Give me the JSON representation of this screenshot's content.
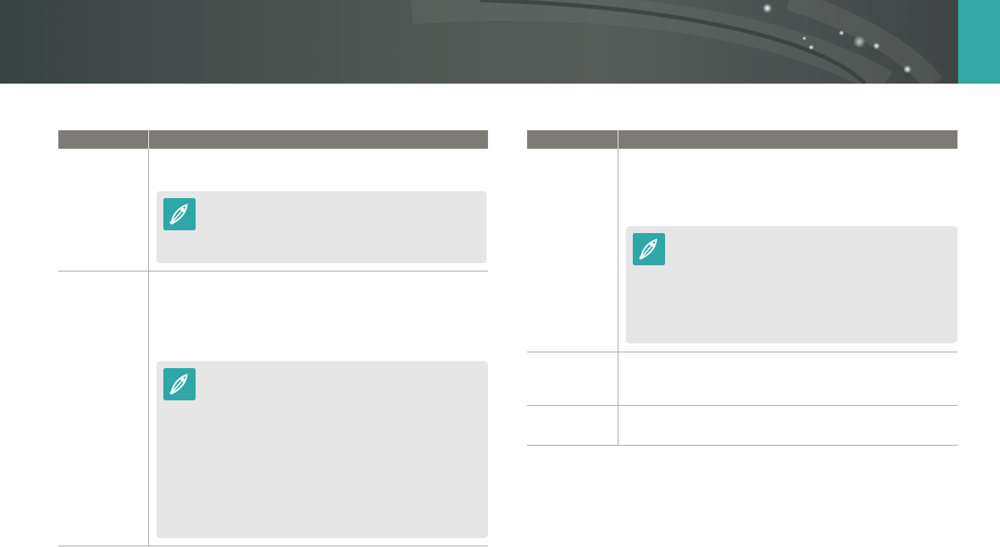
{
  "banner": {
    "accent_color": "#35a6a6"
  },
  "left_table": {
    "header": {
      "col1": "",
      "col2": ""
    },
    "rows": [
      {
        "term": "",
        "desc": "",
        "note_icon": "pen-note-icon",
        "note": ""
      },
      {
        "term": "",
        "desc": "",
        "note_icon": "pen-note-icon",
        "note": ""
      }
    ]
  },
  "right_table": {
    "header": {
      "col1": "",
      "col2": ""
    },
    "rows": [
      {
        "term": "",
        "desc": "",
        "note_icon": "pen-note-icon",
        "note": ""
      },
      {
        "term": "",
        "desc": ""
      },
      {
        "term": "",
        "desc": ""
      }
    ]
  },
  "colors": {
    "header_bg": "#7d7b76",
    "note_bg": "#e6e6e6",
    "icon_bg": "#2fa6a8"
  }
}
